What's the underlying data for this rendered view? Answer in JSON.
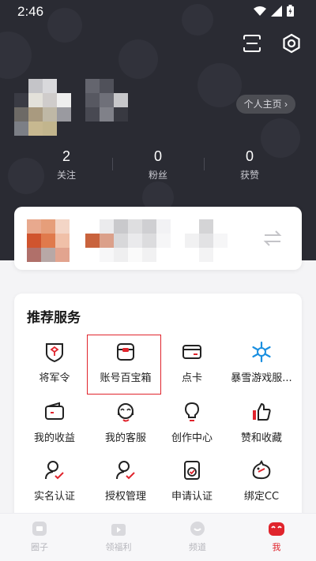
{
  "status_bar": {
    "time": "2:46"
  },
  "profile": {
    "homepage_button": "个人主页",
    "stats": [
      {
        "value": "2",
        "label": "关注"
      },
      {
        "value": "0",
        "label": "粉丝"
      },
      {
        "value": "0",
        "label": "获赞"
      }
    ]
  },
  "services": {
    "title": "推荐服务",
    "items": [
      {
        "label": "将军令",
        "icon": "shield-token-icon"
      },
      {
        "label": "账号百宝箱",
        "icon": "treasure-box-icon",
        "highlighted": true
      },
      {
        "label": "点卡",
        "icon": "card-icon"
      },
      {
        "label": "暴雪游戏服...",
        "icon": "blizzard-icon"
      },
      {
        "label": "我的收益",
        "icon": "wallet-icon"
      },
      {
        "label": "我的客服",
        "icon": "customer-service-icon"
      },
      {
        "label": "创作中心",
        "icon": "lightbulb-icon"
      },
      {
        "label": "赞和收藏",
        "icon": "thumbs-up-icon"
      },
      {
        "label": "实名认证",
        "icon": "user-check-icon"
      },
      {
        "label": "授权管理",
        "icon": "user-authorize-icon"
      },
      {
        "label": "申请认证",
        "icon": "certificate-icon"
      },
      {
        "label": "绑定CC",
        "icon": "cc-bind-icon"
      }
    ]
  },
  "bottom_nav": [
    {
      "label": "圈子",
      "icon": "circle-icon"
    },
    {
      "label": "领福利",
      "icon": "gift-icon"
    },
    {
      "label": "频道",
      "icon": "channel-icon"
    },
    {
      "label": "我",
      "icon": "me-icon",
      "active": true
    }
  ],
  "colors": {
    "accent": "#e0242c",
    "header_bg": "#2a2b33",
    "highlight_border": "#e0242c"
  }
}
